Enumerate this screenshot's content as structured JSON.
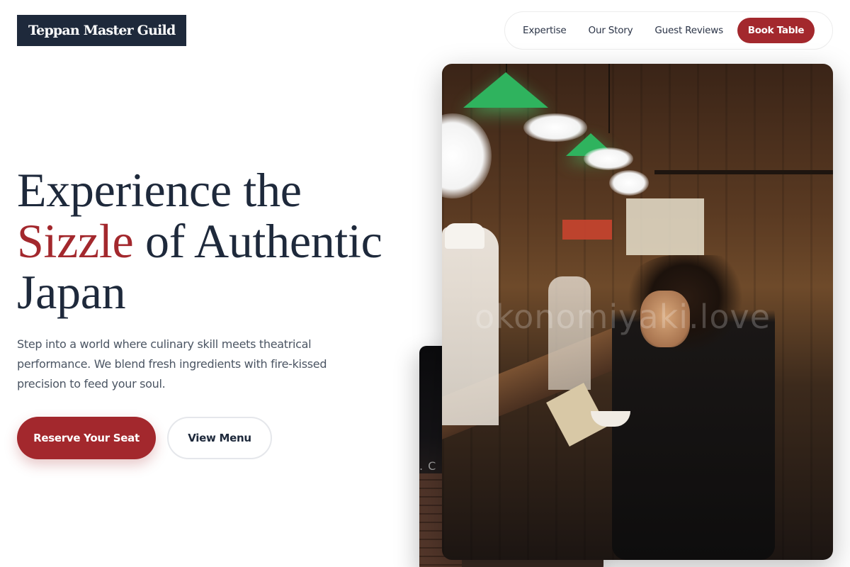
{
  "brand": {
    "logo_text": "Teppan Master Guild"
  },
  "nav": {
    "links": [
      "Expertise",
      "Our Story",
      "Guest Reviews"
    ],
    "cta_label": "Book Table"
  },
  "hero": {
    "title_line1": "Experience the",
    "title_accent": "Sizzle",
    "title_line2_rest": " of Authentic",
    "title_line3": "Japan",
    "description": "Step into a world where culinary skill meets theatrical performance. We blend fresh ingredients with fire-kissed precision to feed your soul.",
    "primary_button": "Reserve Your Seat",
    "secondary_button": "View Menu"
  },
  "images": {
    "main_watermark": "okonomiyaki.love",
    "back_caption": ". C"
  },
  "colors": {
    "primary_dark": "#1e293b",
    "accent_red": "#a3282d",
    "text_muted": "#4b5563",
    "border_light": "#e5e7eb"
  }
}
